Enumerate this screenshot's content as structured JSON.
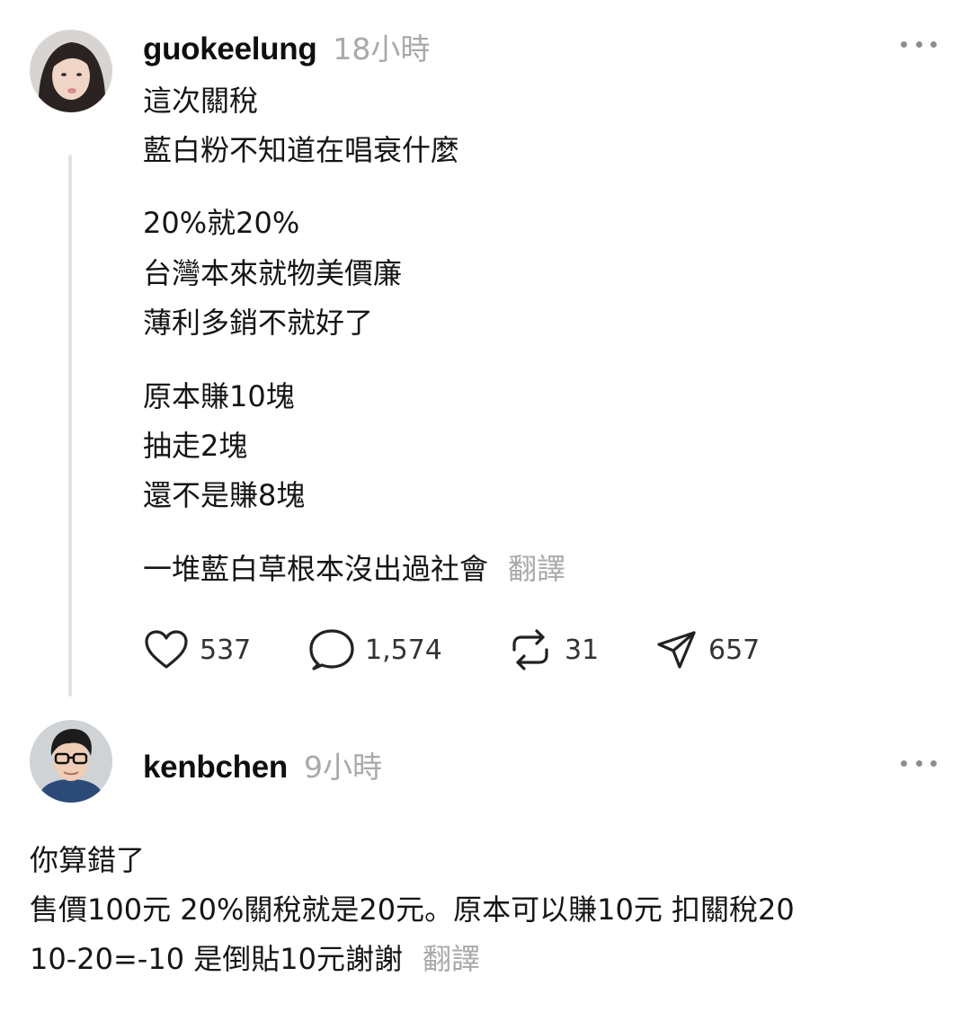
{
  "post": {
    "username": "guokeelung",
    "time": "18小時",
    "lines": [
      "這次關稅",
      "藍白粉不知道在唱衰什麼",
      "20%就20%",
      "台灣本來就物美價廉",
      "薄利多銷不就好了",
      "原本賺10塊",
      "抽走2塊",
      "還不是賺8塊",
      "一堆藍白草根本沒出過社會"
    ],
    "translate_label": "翻譯",
    "actions": {
      "like_count": "537",
      "comment_count": "1,574",
      "repost_count": "31",
      "share_count": "657"
    },
    "icons": [
      "heart-icon",
      "comment-icon",
      "repost-icon",
      "share-icon",
      "more-icon"
    ]
  },
  "reply": {
    "username": "kenbchen",
    "time": "9小時",
    "lines": [
      "你算錯了",
      "售價100元 20%關稅就是20元。原本可以賺10元 扣關稅20",
      "10-20=-10 是倒貼10元謝謝"
    ],
    "translate_label": "翻譯"
  },
  "colors": {
    "text": "#151515",
    "muted": "#a9a9a9",
    "thread_line": "#e3e3e3"
  }
}
